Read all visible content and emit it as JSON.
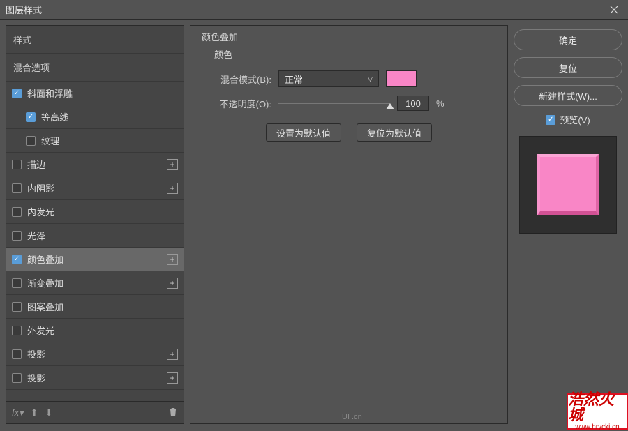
{
  "title": "图层样式",
  "sidebar": {
    "sections": {
      "styles": "样式",
      "blending": "混合选项"
    },
    "items": [
      {
        "label": "斜面和浮雕",
        "checked": true,
        "addable": false
      },
      {
        "label": "等高线",
        "checked": true,
        "addable": false,
        "sub": true
      },
      {
        "label": "纹理",
        "checked": false,
        "addable": false,
        "sub": true
      },
      {
        "label": "描边",
        "checked": false,
        "addable": true
      },
      {
        "label": "内阴影",
        "checked": false,
        "addable": true
      },
      {
        "label": "内发光",
        "checked": false,
        "addable": false
      },
      {
        "label": "光泽",
        "checked": false,
        "addable": false
      },
      {
        "label": "颜色叠加",
        "checked": true,
        "addable": true,
        "selected": true
      },
      {
        "label": "渐变叠加",
        "checked": false,
        "addable": true
      },
      {
        "label": "图案叠加",
        "checked": false,
        "addable": false
      },
      {
        "label": "外发光",
        "checked": false,
        "addable": false
      },
      {
        "label": "投影",
        "checked": false,
        "addable": true
      },
      {
        "label": "投影",
        "checked": false,
        "addable": true
      }
    ],
    "footer_fx": "fx"
  },
  "main": {
    "section_title": "颜色叠加",
    "group_title": "颜色",
    "blend_label": "混合模式(B):",
    "blend_value": "正常",
    "opacity_label": "不透明度(O):",
    "opacity_value": "100",
    "pct": "%",
    "color": "#f986c6",
    "set_default": "设置为默认值",
    "reset_default": "复位为默认值"
  },
  "right": {
    "ok": "确定",
    "cancel": "复位",
    "new_style": "新建样式(W)...",
    "preview": "预览(V)"
  },
  "watermark": {
    "line1": "浩然火城",
    "line2": "www.hryckj.cn"
  },
  "footer_mark": "UI .cn"
}
